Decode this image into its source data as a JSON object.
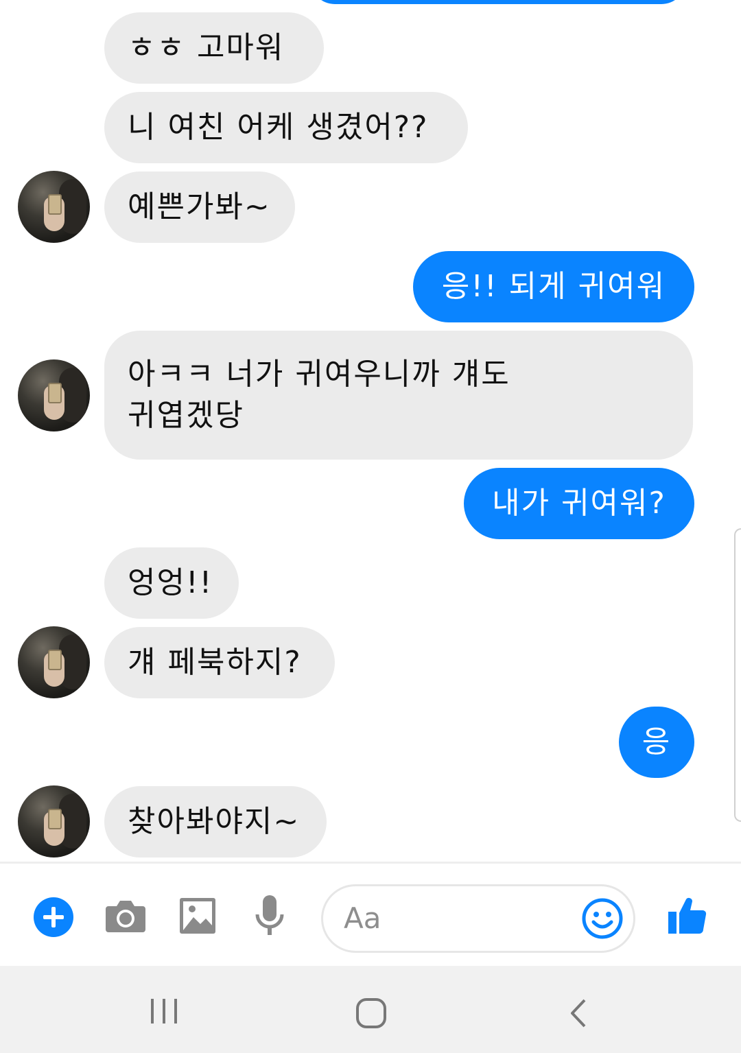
{
  "messages": [
    {
      "side": "in",
      "text": "ㅎㅎ 고마워"
    },
    {
      "side": "in",
      "text": "니 여친 어케 생겼어??"
    },
    {
      "side": "in",
      "text": "예쁜가봐~"
    },
    {
      "side": "out",
      "text": "응!! 되게 귀여워"
    },
    {
      "side": "in",
      "line1": "아ㅋㅋ 너가 귀여우니까 걔도",
      "line2": "귀엽겠당"
    },
    {
      "side": "out",
      "text": "내가 귀여워?"
    },
    {
      "side": "in",
      "text": "엉엉!!"
    },
    {
      "side": "in",
      "text": "걔 페북하지?"
    },
    {
      "side": "out",
      "text": "응"
    },
    {
      "side": "in",
      "text": "찾아봐야지~"
    }
  ],
  "composer": {
    "placeholder": "Aa",
    "icons": [
      "plus-icon",
      "camera-icon",
      "image-icon",
      "microphone-icon",
      "emoji-icon",
      "thumbs-up-icon"
    ]
  },
  "navbar": {
    "icons": [
      "recent-apps-icon",
      "home-icon",
      "back-icon"
    ]
  },
  "colors": {
    "accent": "#0a84ff",
    "incoming_bubble": "#ebebeb",
    "outgoing_text": "#ffffff"
  }
}
